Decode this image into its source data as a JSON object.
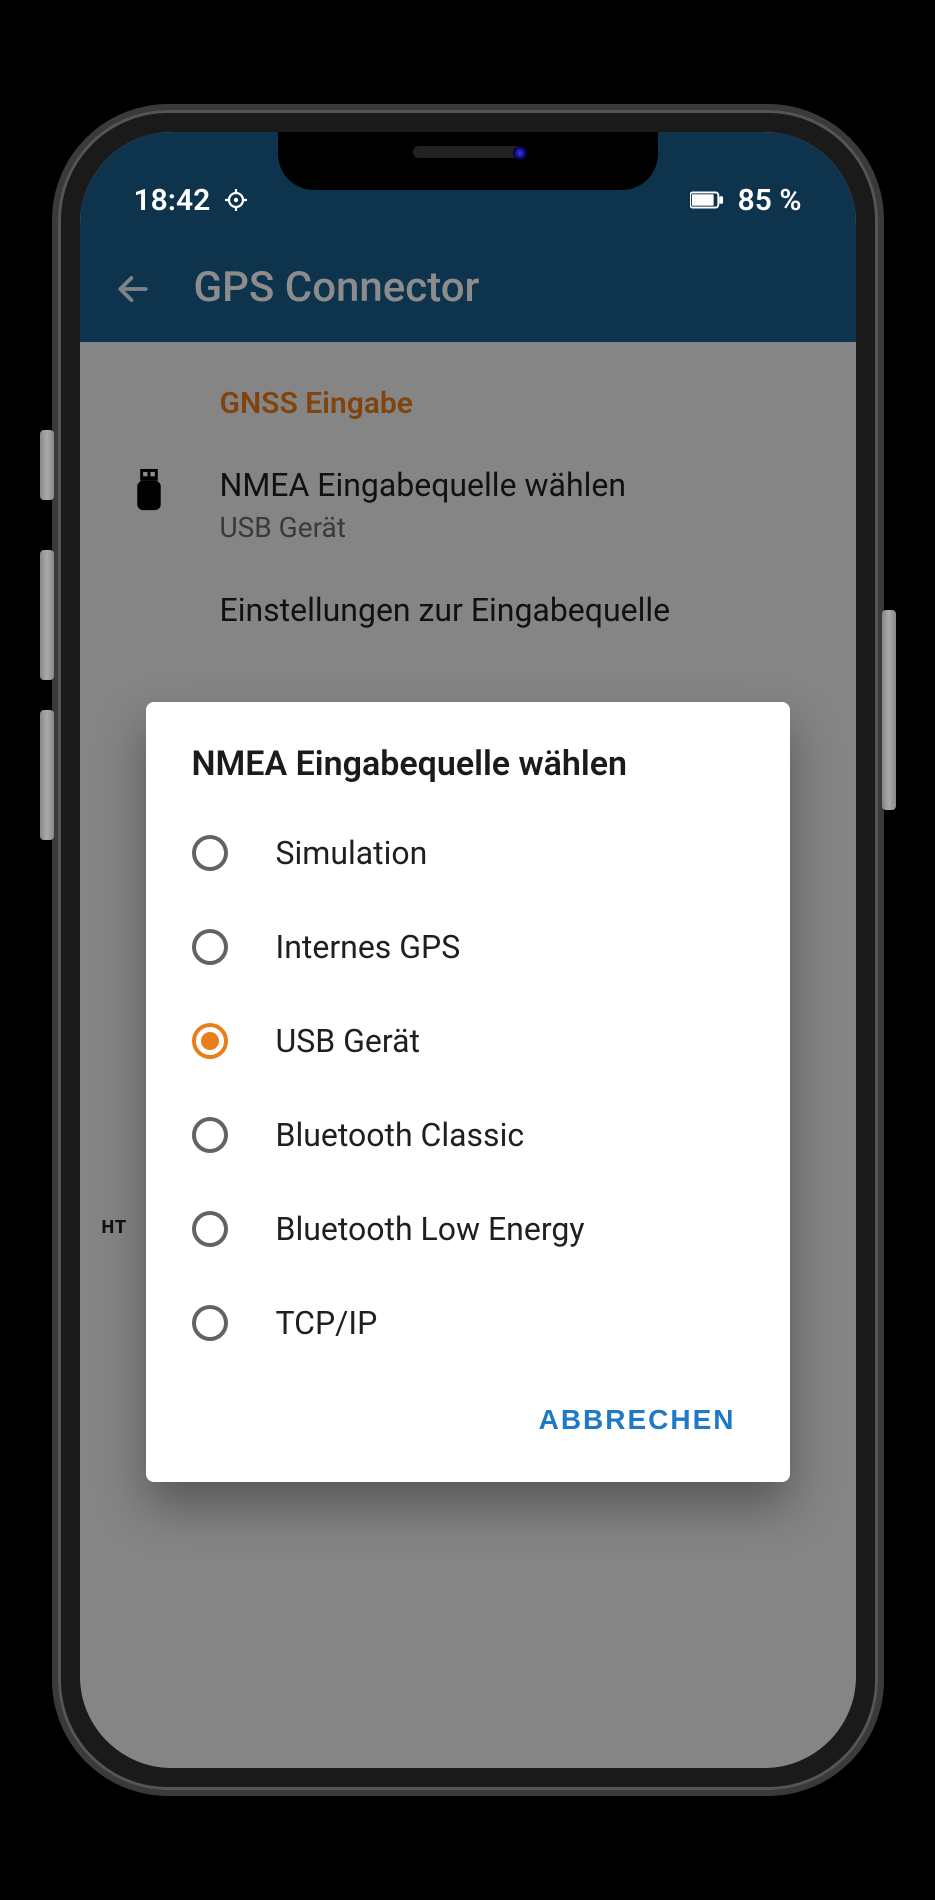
{
  "statusbar": {
    "time": "18:42",
    "battery": "85 %"
  },
  "appbar": {
    "title": "GPS Connector"
  },
  "settings": {
    "section_title": "GNSS Eingabe",
    "nmea_title": "NMEA Eingabequelle wählen",
    "nmea_subtitle": "USB Gerät",
    "source_title": "Einstellungen zur Eingabequelle"
  },
  "dialog": {
    "title": "NMEA Eingabequelle wählen",
    "options": [
      {
        "label": "Simulation",
        "selected": false
      },
      {
        "label": "Internes GPS",
        "selected": false
      },
      {
        "label": "USB Gerät",
        "selected": true
      },
      {
        "label": "Bluetooth Classic",
        "selected": false
      },
      {
        "label": "Bluetooth Low Energy",
        "selected": false
      },
      {
        "label": "TCP/IP",
        "selected": false
      }
    ],
    "cancel": "ABBRECHEN"
  },
  "footer": {
    "ht": "HT"
  }
}
